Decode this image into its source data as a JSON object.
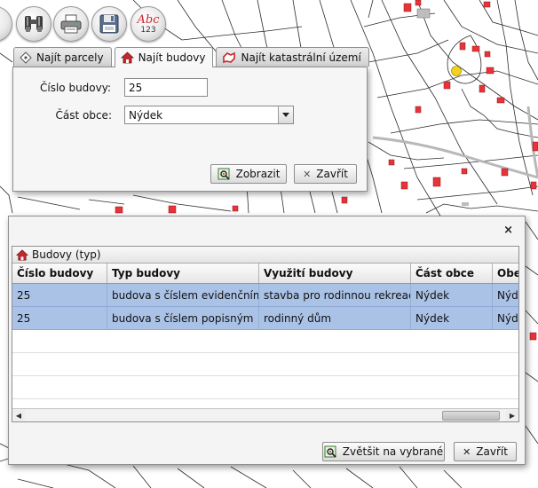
{
  "toolbar": {
    "buttons": [
      {
        "name": "binoculars-icon"
      },
      {
        "name": "print-icon"
      },
      {
        "name": "save-icon"
      },
      {
        "name": "spellcheck-icon",
        "text_top": "Abc",
        "text_bottom": "123"
      }
    ]
  },
  "search": {
    "tabs": [
      {
        "label": "Najít parcely",
        "icon": "parcel-icon"
      },
      {
        "label": "Najít budovy",
        "icon": "house-icon",
        "active": true
      },
      {
        "label": "Najít katastrální území",
        "icon": "cadastral-area-icon"
      }
    ],
    "building_number_label": "Číslo budovy:",
    "building_number_value": "25",
    "municipal_part_label": "Část obce:",
    "municipal_part_value": "Nýdek",
    "show_button": "Zobrazit",
    "close_button": "Zavřít"
  },
  "results": {
    "close_symbol": "×",
    "title": "Budovy (typ)",
    "columns": [
      "Číslo budovy",
      "Typ budovy",
      "Využití budovy",
      "Část obce",
      "Obe"
    ],
    "rows": [
      [
        "25",
        "budova s číslem evidenčním",
        "stavba pro rodinnou rekreaci",
        "Nýdek",
        "Nýd"
      ],
      [
        "25",
        "budova s číslem popisným",
        "rodinný dům",
        "Nýdek",
        "Nýd"
      ]
    ],
    "zoom_button": "Zvětšit na vybrané",
    "close_button": "Zavřít"
  },
  "colors": {
    "selection": "#a9c2e6",
    "building_red": "#e8333a",
    "building_yellow": "#f2d21a",
    "house_icon_red": "#c3282f"
  }
}
